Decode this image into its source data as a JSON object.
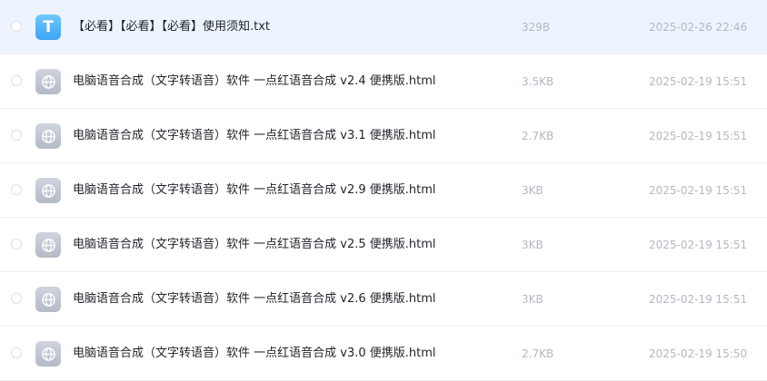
{
  "files": [
    {
      "icon": "txt-file-icon",
      "icon_letter": "T",
      "name": "【必看】【必看】【必看】使用须知.txt",
      "size": "329B",
      "date": "2025-02-26 22:46"
    },
    {
      "icon": "html-file-icon",
      "name": "电脑语音合成（文字转语音）软件 一点红语音合成 v2.4 便携版.html",
      "size": "3.5KB",
      "date": "2025-02-19 15:51"
    },
    {
      "icon": "html-file-icon",
      "name": "电脑语音合成（文字转语音）软件 一点红语音合成 v3.1 便携版.html",
      "size": "2.7KB",
      "date": "2025-02-19 15:51"
    },
    {
      "icon": "html-file-icon",
      "name": "电脑语音合成（文字转语音）软件 一点红语音合成 v2.9 便携版.html",
      "size": "3KB",
      "date": "2025-02-19 15:51"
    },
    {
      "icon": "html-file-icon",
      "name": "电脑语音合成（文字转语音）软件 一点红语音合成 v2.5 便携版.html",
      "size": "3KB",
      "date": "2025-02-19 15:51"
    },
    {
      "icon": "html-file-icon",
      "name": "电脑语音合成（文字转语音）软件 一点红语音合成 v2.6 便携版.html",
      "size": "3KB",
      "date": "2025-02-19 15:51"
    },
    {
      "icon": "html-file-icon",
      "name": "电脑语音合成（文字转语音）软件 一点红语音合成 v3.0 便携版.html",
      "size": "2.7KB",
      "date": "2025-02-19 15:50"
    }
  ],
  "colors": {
    "hover_row_background": "#eef4ff",
    "txt_icon": "#4fb3fb",
    "html_icon": "#c2c8d2",
    "meta_text": "#b3b8c2"
  }
}
